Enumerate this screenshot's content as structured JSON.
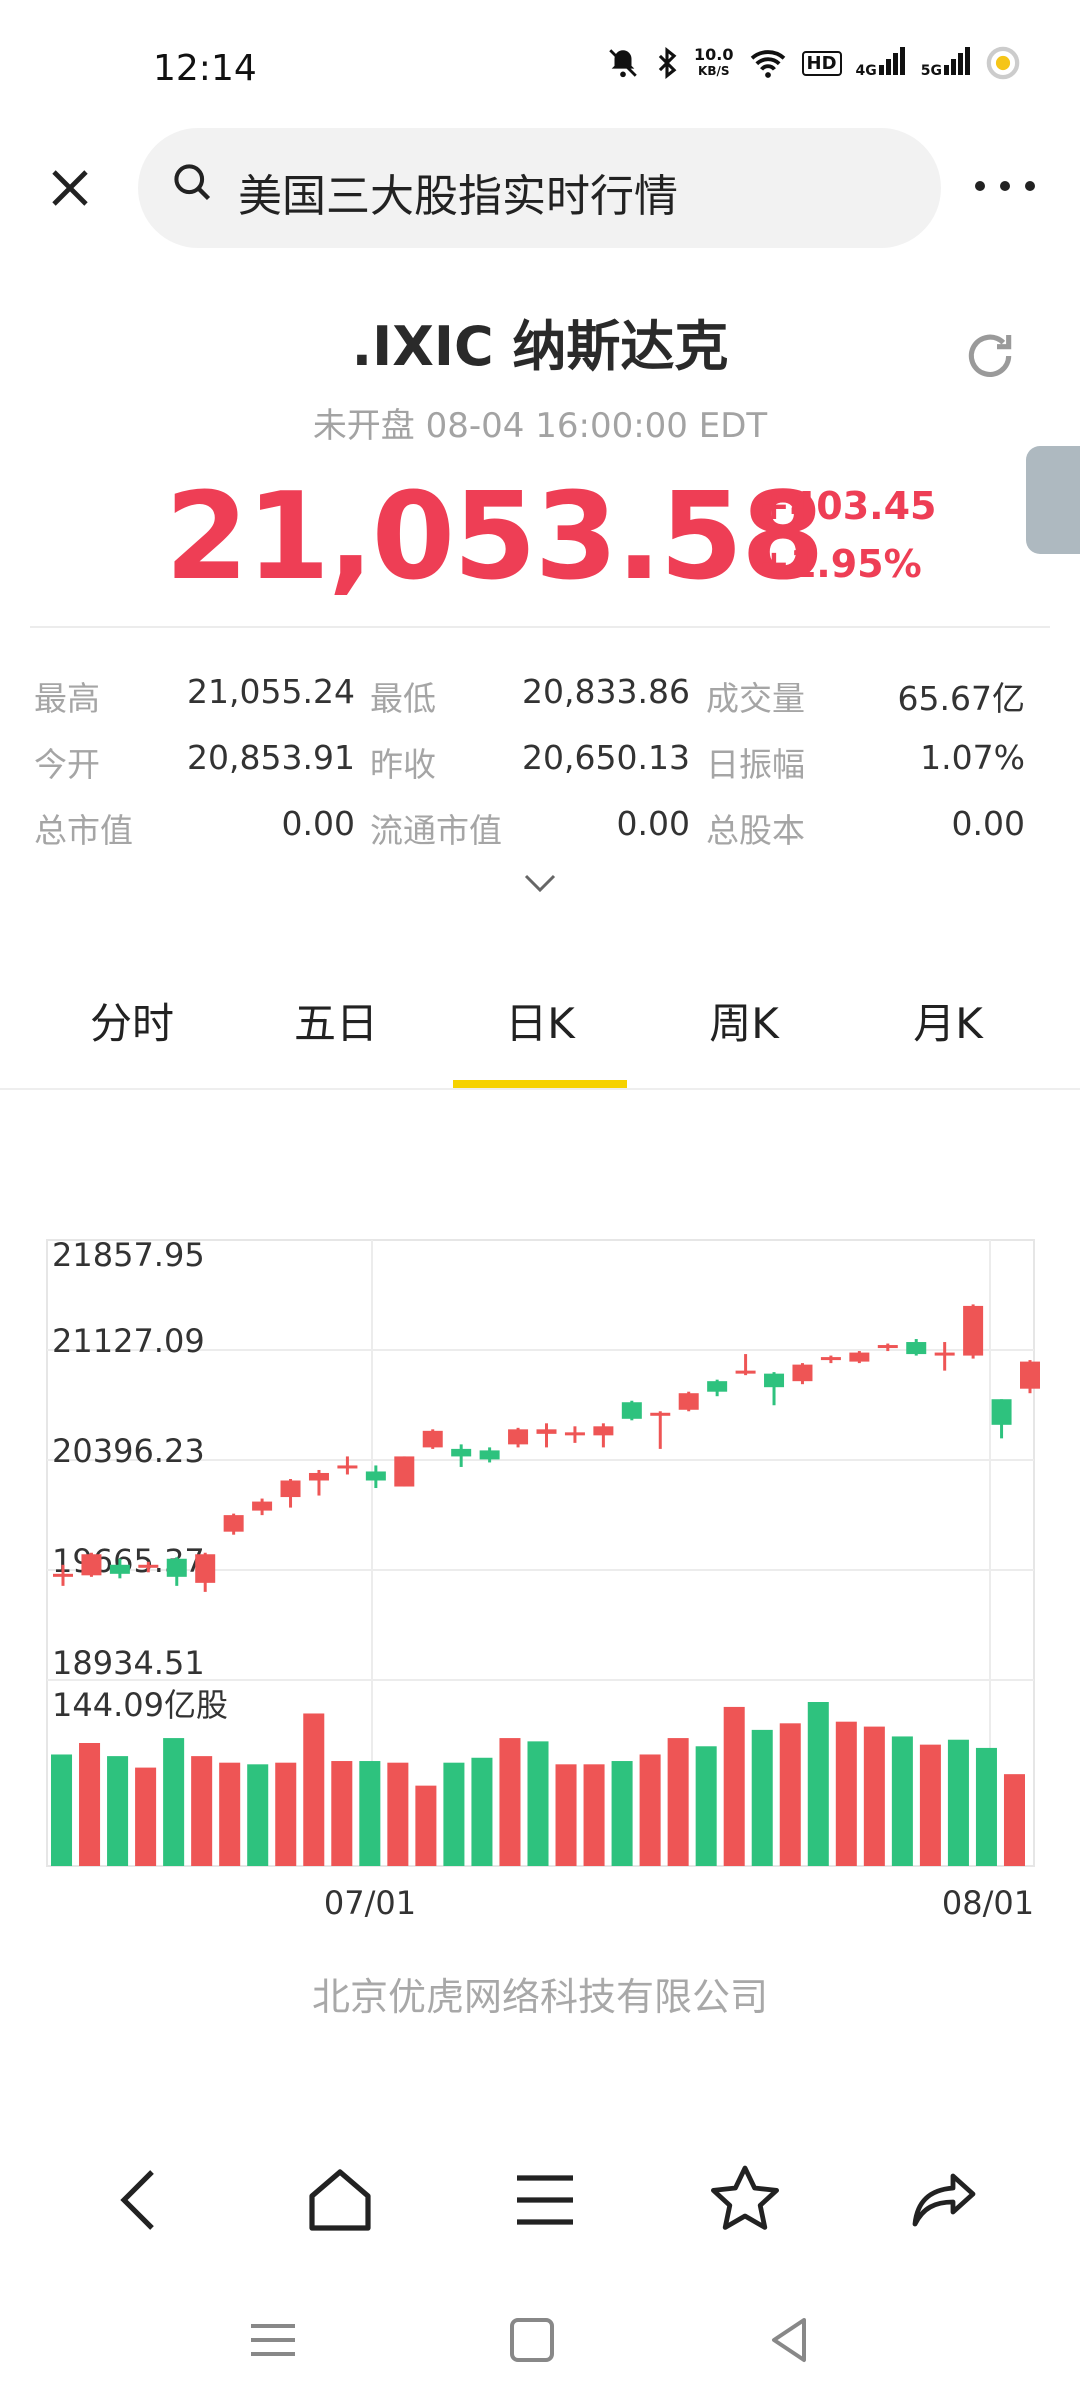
{
  "status_bar": {
    "time": "12:14",
    "net_speed_value": "10.0",
    "net_speed_unit": "KB/S",
    "hd_badge": "HD",
    "sig1_label": "4G",
    "sig2_label": "5G"
  },
  "search": {
    "query": "美国三大股指实时行情"
  },
  "stock": {
    "title": ".IXIC 纳斯达克",
    "market_status": "未开盘 08-04 16:00:00 EDT",
    "price": "21,053.58",
    "change_abs": "+403.45",
    "change_pct": "+1.95%"
  },
  "stats": [
    [
      {
        "label": "最高",
        "value": "21,055.24"
      },
      {
        "label": "最低",
        "value": "20,833.86"
      },
      {
        "label": "成交量",
        "value": "65.67亿"
      }
    ],
    [
      {
        "label": "今开",
        "value": "20,853.91"
      },
      {
        "label": "昨收",
        "value": "20,650.13"
      },
      {
        "label": "日振幅",
        "value": "1.07%"
      }
    ],
    [
      {
        "label": "总市值",
        "value": "0.00"
      },
      {
        "label": "流通市值",
        "value": "0.00"
      },
      {
        "label": "总股本",
        "value": "0.00"
      }
    ]
  ],
  "tabs": [
    {
      "label": "分时",
      "active": false
    },
    {
      "label": "五日",
      "active": false
    },
    {
      "label": "日K",
      "active": true
    },
    {
      "label": "周K",
      "active": false
    },
    {
      "label": "月K",
      "active": false
    }
  ],
  "chart_data": {
    "type": "candlestick",
    "y_ticks": [
      "21857.95",
      "21127.09",
      "20396.23",
      "19665.37",
      "18934.51"
    ],
    "y_range": [
      18934.51,
      21857.95
    ],
    "volume_label": "144.09亿股",
    "x_labels": [
      "07/01",
      "08/01"
    ],
    "up_color": "#ee5555",
    "down_color": "#2ec27e",
    "candles": [
      {
        "o": 19620,
        "c": 19640,
        "h": 19700,
        "l": 19560
      },
      {
        "o": 19630,
        "c": 19770,
        "h": 19780,
        "l": 19620
      },
      {
        "o": 19700,
        "c": 19640,
        "h": 19740,
        "l": 19610
      },
      {
        "o": 19680,
        "c": 19700,
        "h": 19720,
        "l": 19650
      },
      {
        "o": 19740,
        "c": 19620,
        "h": 19750,
        "l": 19560
      },
      {
        "o": 19580,
        "c": 19770,
        "h": 19780,
        "l": 19520
      },
      {
        "o": 19920,
        "c": 20030,
        "h": 20040,
        "l": 19900
      },
      {
        "o": 20060,
        "c": 20120,
        "h": 20140,
        "l": 20030
      },
      {
        "o": 20150,
        "c": 20260,
        "h": 20270,
        "l": 20080
      },
      {
        "o": 20260,
        "c": 20310,
        "h": 20330,
        "l": 20160
      },
      {
        "o": 20340,
        "c": 20360,
        "h": 20420,
        "l": 20300
      },
      {
        "o": 20320,
        "c": 20260,
        "h": 20360,
        "l": 20210
      },
      {
        "o": 20220,
        "c": 20420,
        "h": 20420,
        "l": 20220
      },
      {
        "o": 20480,
        "c": 20590,
        "h": 20600,
        "l": 20470
      },
      {
        "o": 20470,
        "c": 20420,
        "h": 20500,
        "l": 20350
      },
      {
        "o": 20460,
        "c": 20400,
        "h": 20480,
        "l": 20380
      },
      {
        "o": 20500,
        "c": 20600,
        "h": 20610,
        "l": 20480
      },
      {
        "o": 20570,
        "c": 20600,
        "h": 20640,
        "l": 20480
      },
      {
        "o": 20570,
        "c": 20580,
        "h": 20620,
        "l": 20510
      },
      {
        "o": 20560,
        "c": 20620,
        "h": 20640,
        "l": 20480
      },
      {
        "o": 20780,
        "c": 20670,
        "h": 20790,
        "l": 20660
      },
      {
        "o": 20690,
        "c": 20710,
        "h": 20720,
        "l": 20470
      },
      {
        "o": 20730,
        "c": 20840,
        "h": 20850,
        "l": 20720
      },
      {
        "o": 20920,
        "c": 20850,
        "h": 20930,
        "l": 20820
      },
      {
        "o": 20970,
        "c": 20990,
        "h": 21100,
        "l": 20960
      },
      {
        "o": 20970,
        "c": 20880,
        "h": 20980,
        "l": 20760
      },
      {
        "o": 20920,
        "c": 21030,
        "h": 21040,
        "l": 20900
      },
      {
        "o": 21060,
        "c": 21080,
        "h": 21090,
        "l": 21040
      },
      {
        "o": 21050,
        "c": 21110,
        "h": 21120,
        "l": 21040
      },
      {
        "o": 21140,
        "c": 21160,
        "h": 21170,
        "l": 21120
      },
      {
        "o": 21180,
        "c": 21100,
        "h": 21200,
        "l": 21090
      },
      {
        "o": 21090,
        "c": 21110,
        "h": 21180,
        "l": 20990
      },
      {
        "o": 21090,
        "c": 21420,
        "h": 21430,
        "l": 21070
      },
      {
        "o": 20800,
        "c": 20630,
        "h": 20800,
        "l": 20540
      },
      {
        "o": 20870,
        "c": 21050,
        "h": 21060,
        "l": 20840
      }
    ],
    "volumes": [
      {
        "v": 0.68,
        "up": false
      },
      {
        "v": 0.75,
        "up": true
      },
      {
        "v": 0.67,
        "up": false
      },
      {
        "v": 0.6,
        "up": true
      },
      {
        "v": 0.78,
        "up": false
      },
      {
        "v": 0.67,
        "up": true
      },
      {
        "v": 0.63,
        "up": true
      },
      {
        "v": 0.62,
        "up": false
      },
      {
        "v": 0.63,
        "up": true
      },
      {
        "v": 0.93,
        "up": true
      },
      {
        "v": 0.64,
        "up": true
      },
      {
        "v": 0.64,
        "up": false
      },
      {
        "v": 0.63,
        "up": true
      },
      {
        "v": 0.49,
        "up": true
      },
      {
        "v": 0.63,
        "up": false
      },
      {
        "v": 0.66,
        "up": false
      },
      {
        "v": 0.78,
        "up": true
      },
      {
        "v": 0.76,
        "up": false
      },
      {
        "v": 0.62,
        "up": true
      },
      {
        "v": 0.62,
        "up": true
      },
      {
        "v": 0.64,
        "up": false
      },
      {
        "v": 0.68,
        "up": true
      },
      {
        "v": 0.78,
        "up": true
      },
      {
        "v": 0.73,
        "up": false
      },
      {
        "v": 0.97,
        "up": true
      },
      {
        "v": 0.83,
        "up": false
      },
      {
        "v": 0.87,
        "up": true
      },
      {
        "v": 1.0,
        "up": false
      },
      {
        "v": 0.88,
        "up": true
      },
      {
        "v": 0.85,
        "up": true
      },
      {
        "v": 0.79,
        "up": false
      },
      {
        "v": 0.74,
        "up": true
      },
      {
        "v": 0.77,
        "up": false
      },
      {
        "v": 0.72,
        "up": false
      },
      {
        "v": 0.56,
        "up": true
      }
    ]
  },
  "watermark": "北京优虎网络科技有限公司",
  "nav": {
    "back": "back-icon",
    "home": "home-icon",
    "menu": "menu-icon",
    "favorite": "star-icon",
    "share": "share-icon"
  }
}
